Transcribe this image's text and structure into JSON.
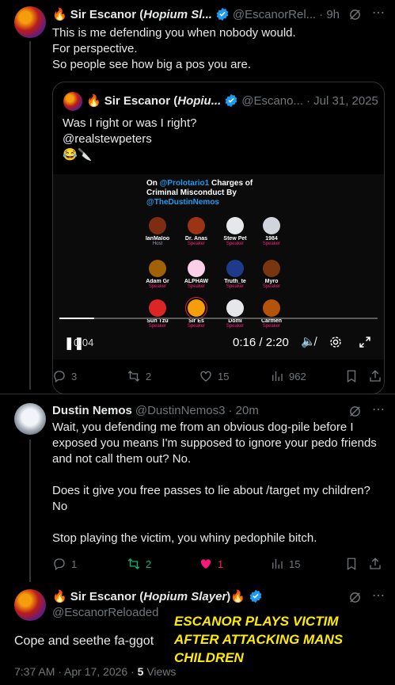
{
  "post1": {
    "name_prefix": "🔥",
    "name": "Sir Escanor (",
    "name_italic": "Hopium Sl...",
    "handle": "@EscanorRel...",
    "time": "· 9h",
    "text": "This is me defending you when nobody would.\nFor perspective.\nSo people see how big a pos you are."
  },
  "quoted": {
    "name_prefix": "🔥",
    "name": "Sir Escanor (",
    "name_italic": "Hopiu...",
    "handle": "@Escano...",
    "time": "· Jul 31, 2025",
    "text": "Was I right or was I right?\n@realstewpeters\n😂🔪",
    "video": {
      "title_pre": "On ",
      "title_link": "@Prolotario1",
      "title_mid": " Charges of Criminal Misconduct By ",
      "title_link2": "@TheDustinNemos",
      "speakers": [
        {
          "label": "IanMaloo",
          "role": "Host",
          "color": "#7c2d12"
        },
        {
          "label": "Dr. Anas",
          "role": "Speaker",
          "color": "#9a3412"
        },
        {
          "label": "Stew Pet",
          "role": "Speaker",
          "color": "#e5e7eb"
        },
        {
          "label": "1984",
          "role": "Speaker",
          "color": "#d1d5db"
        },
        {
          "label": "Adam Gr",
          "role": "Speaker",
          "color": "#a16207"
        },
        {
          "label": "ALPHAW",
          "role": "Speaker",
          "color": "#fbcfe8"
        },
        {
          "label": "Truth_te",
          "role": "Speaker",
          "color": "#1e3a8a"
        },
        {
          "label": "Myro",
          "role": "Speaker",
          "color": "#78350f"
        },
        {
          "label": "Sun Tzu",
          "role": "Speaker",
          "color": "#dc2626"
        },
        {
          "label": "Sir Es",
          "role": "Speaker",
          "color": "#f59e0b"
        },
        {
          "label": "Domi",
          "role": "Speaker",
          "color": "#e5e7eb"
        },
        {
          "label": "Carmen",
          "role": "Speaker",
          "color": "#b45309"
        }
      ],
      "elapsed_left": "0:04",
      "time": "0:16 / 2:20",
      "progress": 0.11
    }
  },
  "post1_actions": {
    "replies": "3",
    "reposts": "2",
    "likes": "15",
    "views": "962"
  },
  "post2": {
    "name": "Dustin Nemos",
    "handle": "@DustinNemos3",
    "time": "· 20m",
    "text": "Wait, you defending me from an obvious dog-pile before I exposed you means I'm supposed to ignore your pedo friends and not call them out? No.\n\nDoes it give you free passes to lie about /target my children? No\n\nStop playing the victim, you whiny pedophile bitch."
  },
  "post2_actions": {
    "replies": "1",
    "reposts": "2",
    "likes": "1",
    "views": "15"
  },
  "post3": {
    "name_prefix": "🔥",
    "name": "Sir Escanor (",
    "name_italic": "Hopium Slayer",
    "name_suffix": ")🔥",
    "handle": "@EscanorReloaded",
    "text": "Cope and seethe fa-ggot",
    "timestamp": "7:37 AM · Apr 17, 2026 · ",
    "views_count": "5",
    "views_label": " Views"
  },
  "overlay": {
    "line1": "ESCANOR PLAYS VICTIM",
    "line2": "AFTER ATTACKING MANS",
    "line3": "CHILDREN"
  },
  "colors": {
    "accent": "#1d9bf0",
    "repost_active": "#00ba7c",
    "like_active": "#f91880",
    "overlay": "#ffeb00"
  },
  "icons": [
    "verified-badge-icon",
    "grok-icon",
    "more-icon",
    "reply-icon",
    "repost-icon",
    "like-icon",
    "views-icon",
    "bookmark-icon",
    "share-icon",
    "pause-icon",
    "mute-icon",
    "settings-icon",
    "fullscreen-icon"
  ]
}
